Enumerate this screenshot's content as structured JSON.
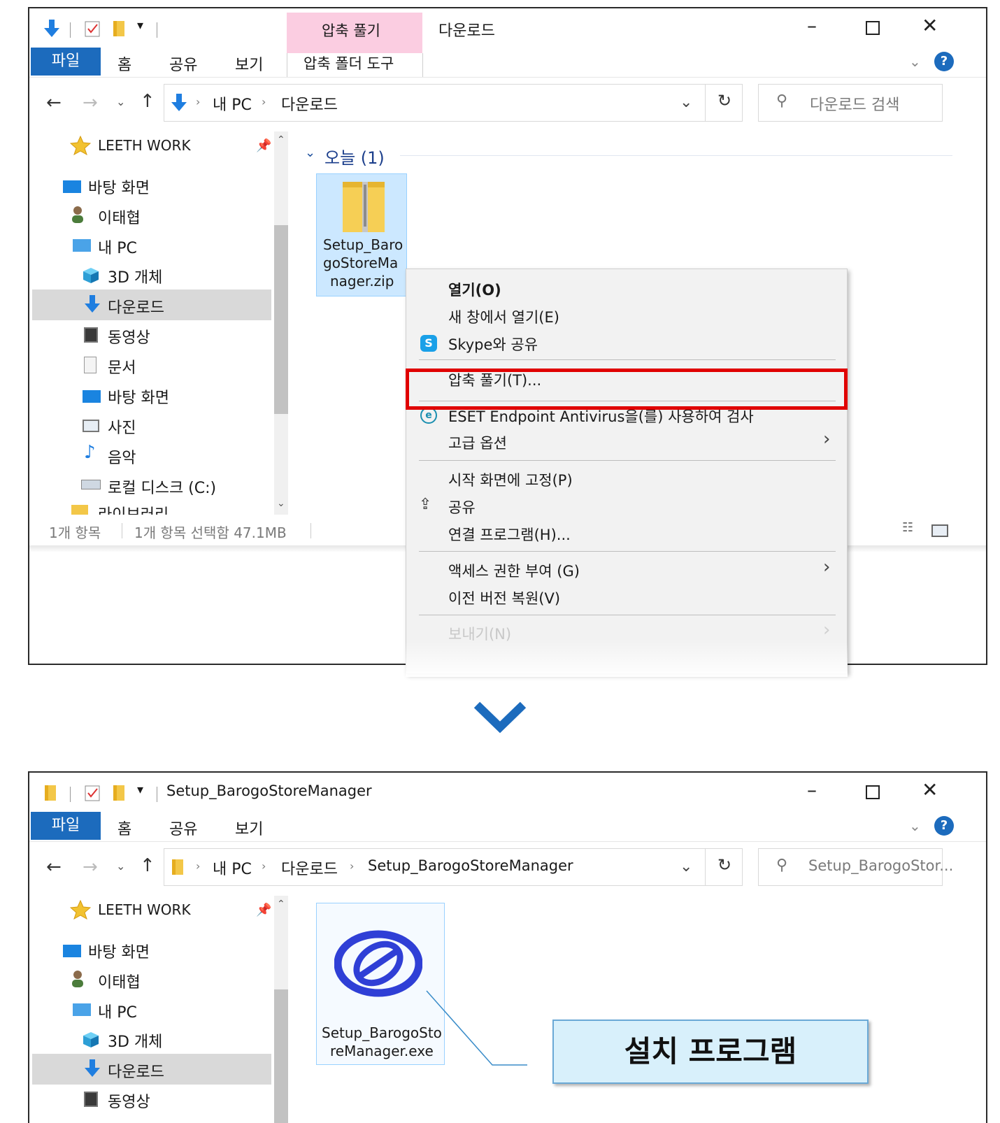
{
  "window1": {
    "contextual_tab_group": "압축 풀기",
    "title": "다운로드",
    "ribbon_tabs": [
      "파일",
      "홈",
      "공유",
      "보기"
    ],
    "contextual_tab": "압축 폴더 도구",
    "address": {
      "crumbs": [
        "내 PC",
        "다운로드"
      ]
    },
    "search_placeholder": "다운로드 검색",
    "nav": {
      "quick_access": "LEETH WORK",
      "items": [
        "바탕 화면",
        "이태협",
        "내 PC",
        "3D 개체",
        "다운로드",
        "동영상",
        "문서",
        "바탕 화면",
        "사진",
        "음악",
        "로컬 디스크 (C:)",
        "라이브러리"
      ]
    },
    "group_header": "오늘 (1)",
    "file": {
      "line1": "Setup_Baro",
      "line2": "goStoreMa",
      "line3": "nager.zip"
    },
    "status": {
      "count": "1개 항목",
      "selected": "1개 항목 선택함 47.1MB"
    },
    "context_menu": {
      "open": "열기(O)",
      "open_new": "새 창에서 열기(E)",
      "skype": "Skype와 공유",
      "extract": "압축 풀기(T)...",
      "eset": "ESET Endpoint Antivirus을(를) 사용하여 검사",
      "advanced": "고급 옵션",
      "pin_start": "시작 화면에 고정(P)",
      "share": "공유",
      "open_with": "연결 프로그램(H)...",
      "grant_access": "액세스 권한 부여 (G)",
      "restore": "이전 버전 복원(V)",
      "send_to": "보내기(N)"
    }
  },
  "window2": {
    "title": "Setup_BarogoStoreManager",
    "ribbon_tabs": [
      "파일",
      "홈",
      "공유",
      "보기"
    ],
    "address": {
      "crumbs": [
        "내 PC",
        "다운로드",
        "Setup_BarogoStoreManager"
      ]
    },
    "search_placeholder": "Setup_BarogoStor...",
    "nav": {
      "quick_access": "LEETH WORK",
      "items": [
        "바탕 화면",
        "이태협",
        "내 PC",
        "3D 개체",
        "다운로드",
        "동영상"
      ]
    },
    "file": {
      "line1": "Setup_BarogoSto",
      "line2": "reManager.exe"
    },
    "callout": "설치 프로그램"
  },
  "colors": {
    "accent": "#1c6bbd",
    "highlight": "#e00000",
    "logo": "#2f3fd6",
    "callout_bg": "#d8f0fb"
  }
}
